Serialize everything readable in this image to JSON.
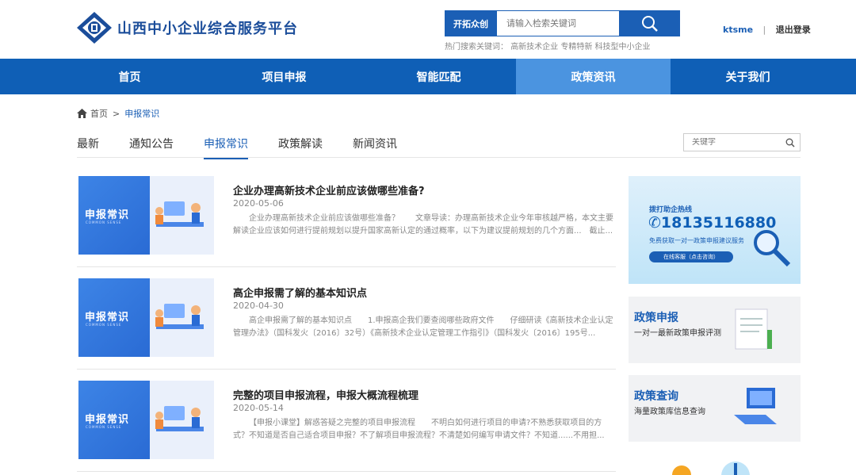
{
  "header": {
    "logo_text": "山西中小企业综合服务平台",
    "search_tag": "开拓众创",
    "search_placeholder": "请输入检索关键词",
    "hot_label": "热门搜索关键词：",
    "hot_keywords": "高新技术企业 专精特新 科技型中小企业",
    "username": "ktsme",
    "separator": "|",
    "logout": "退出登录"
  },
  "nav": [
    {
      "label": "首页"
    },
    {
      "label": "项目申报"
    },
    {
      "label": "智能匹配"
    },
    {
      "label": "政策资讯",
      "active": true
    },
    {
      "label": "关于我们"
    }
  ],
  "breadcrumb": {
    "home": "首页",
    "arrow": ">",
    "current": "申报常识"
  },
  "tabs": [
    {
      "label": "最新"
    },
    {
      "label": "通知公告"
    },
    {
      "label": "申报常识",
      "active": true
    },
    {
      "label": "政策解读"
    },
    {
      "label": "新闻资讯"
    }
  ],
  "keyword_placeholder": "关键字",
  "thumb": {
    "label": "申报常识",
    "sub": "COMMON SENSE"
  },
  "articles": [
    {
      "title": "企业办理高新技术企业前应该做哪些准备?",
      "date": "2020-05-06",
      "summary": "企业办理高新技术企业前应该做哪些准备？　　文章导读：办理高新技术企业今年审核越严格，本文主要解读企业应该如何进行提前规划以提升国家高新认定的通过概率，以下为建议提前规划的几个方面...　截止..."
    },
    {
      "title": "高企申报需了解的基本知识点",
      "date": "2020-04-30",
      "summary": "高企申报需了解的基本知识点　　1.申报高企我们要查阅哪些政府文件　　仔细研读《高新技术企业认定管理办法》（国科发火〔2016〕32号）《高新技术企业认定管理工作指引》（国科发火〔2016〕195号..."
    },
    {
      "title": "完整的项目申报流程，申报大概流程梳理",
      "date": "2020-05-14",
      "summary": "【申报小课堂】解惑答疑之完整的项目申报流程　　不明白如何进行项目的申请?不熟悉获取项目的方式？不知道是否自己适合项目申报？不了解项目申报流程？不清楚如何编写申请文件？不知道......不用担..."
    }
  ],
  "sidebar": {
    "hotline_title": "拨打助企热线",
    "hotline_number": "18135116880",
    "hotline_desc": "免费获取一对一政策申报建议服务",
    "hotline_btn": "在线客服（点击咨询）",
    "cards": [
      {
        "title": "政策申报",
        "desc": "一对一最新政策申报评测"
      },
      {
        "title": "政策查询",
        "desc": "海量政策库信息查询"
      }
    ]
  },
  "colors": {
    "brand": "#0f5fb6",
    "active_nav": "#4b94e0",
    "accent_text": "#1b5fb5"
  }
}
